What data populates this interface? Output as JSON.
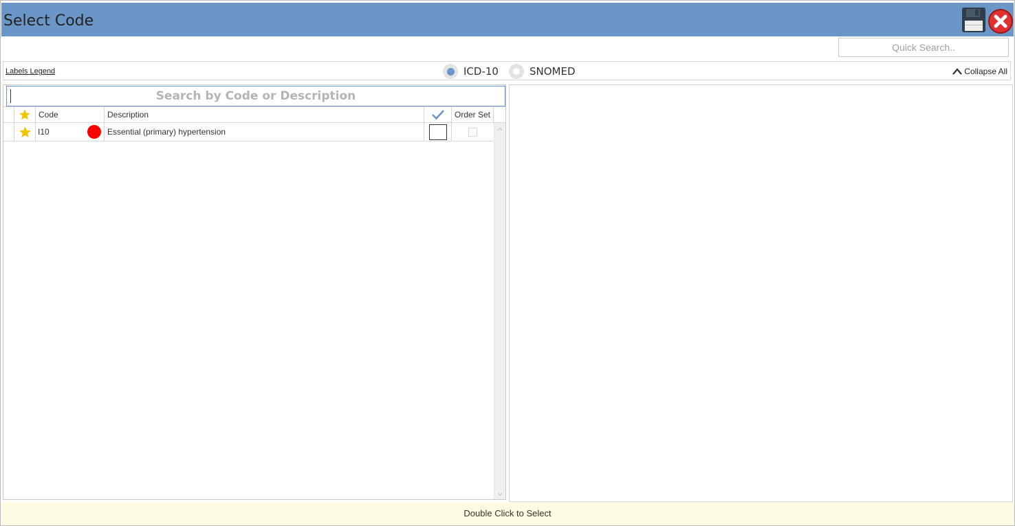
{
  "window": {
    "title": "Select Code",
    "save_icon": "floppy-disk-icon",
    "close_icon": "close-circle-icon",
    "accent_color": "#6b96c8"
  },
  "quick_search": {
    "placeholder": "Quick Search..",
    "value": ""
  },
  "toolbar": {
    "legend_link": "Labels Legend",
    "code_systems": [
      {
        "label": "ICD-10",
        "selected": true
      },
      {
        "label": "SNOMED",
        "selected": false
      }
    ],
    "collapse_label": "Collapse All"
  },
  "grid": {
    "search_placeholder": "Search by Code or Description",
    "columns": {
      "favorite_icon": "star-icon",
      "code": "Code",
      "description": "Description",
      "selected_icon": "checkmark-icon",
      "order_set": "Order Set"
    },
    "rows": [
      {
        "favorite": true,
        "code": "I10",
        "status_color": "#ff0000",
        "description": "Essential (primary) hypertension",
        "selected": false,
        "order_set": false
      }
    ]
  },
  "status_bar": {
    "text": "Double Click to Select"
  }
}
